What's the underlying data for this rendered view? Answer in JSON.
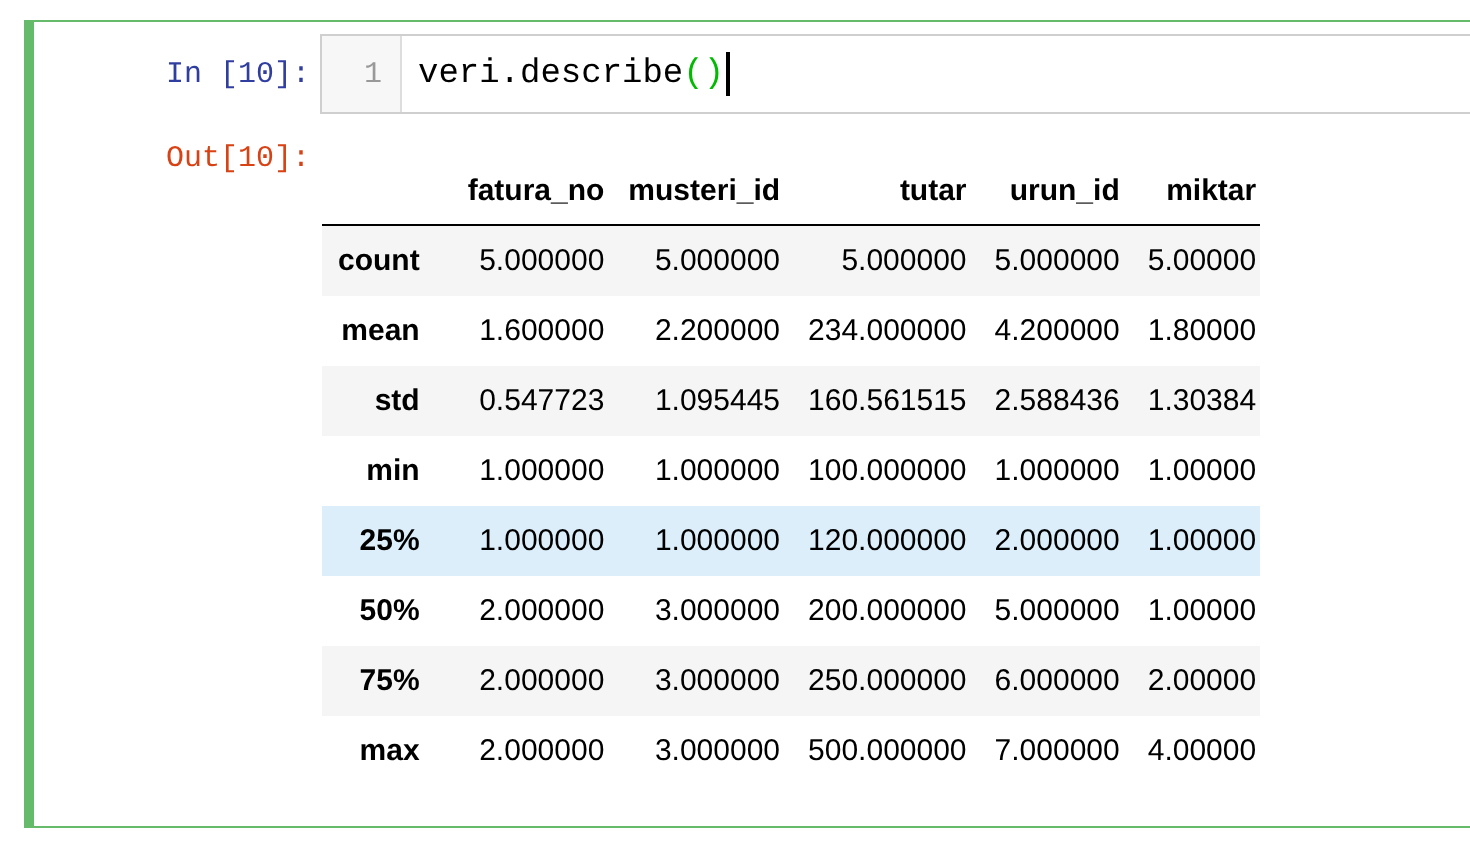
{
  "cell": {
    "selected": true,
    "in_prompt": "In [10]:",
    "line_number": "1",
    "code_tokens": [
      {
        "kind": "name",
        "text": "veri.describe"
      },
      {
        "kind": "bracket",
        "text": "()"
      }
    ],
    "out_prompt": "Out[10]:",
    "table": {
      "columns": [
        "fatura_no",
        "musteri_id",
        "tutar",
        "urun_id",
        "miktar"
      ],
      "rows": [
        {
          "label": "count",
          "values": [
            "5.000000",
            "5.000000",
            "5.000000",
            "5.000000",
            "5.00000"
          ],
          "highlighted": false
        },
        {
          "label": "mean",
          "values": [
            "1.600000",
            "2.200000",
            "234.000000",
            "4.200000",
            "1.80000"
          ],
          "highlighted": false
        },
        {
          "label": "std",
          "values": [
            "0.547723",
            "1.095445",
            "160.561515",
            "2.588436",
            "1.30384"
          ],
          "highlighted": false
        },
        {
          "label": "min",
          "values": [
            "1.000000",
            "1.000000",
            "100.000000",
            "1.000000",
            "1.00000"
          ],
          "highlighted": false
        },
        {
          "label": "25%",
          "values": [
            "1.000000",
            "1.000000",
            "120.000000",
            "2.000000",
            "1.00000"
          ],
          "highlighted": true
        },
        {
          "label": "50%",
          "values": [
            "2.000000",
            "3.000000",
            "200.000000",
            "5.000000",
            "1.00000"
          ],
          "highlighted": false
        },
        {
          "label": "75%",
          "values": [
            "2.000000",
            "3.000000",
            "250.000000",
            "6.000000",
            "2.00000"
          ],
          "highlighted": false
        },
        {
          "label": "max",
          "values": [
            "2.000000",
            "3.000000",
            "500.000000",
            "7.000000",
            "4.00000"
          ],
          "highlighted": false
        }
      ]
    }
  }
}
